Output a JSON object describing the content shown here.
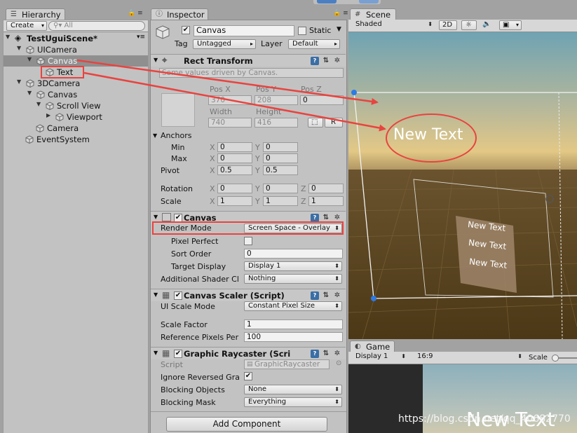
{
  "hierarchy": {
    "tab": "Hierarchy",
    "create": "Create",
    "search_placeholder": "All",
    "items": [
      {
        "label": "TestUguiScene*"
      },
      {
        "label": "UICamera"
      },
      {
        "label": "Canvas"
      },
      {
        "label": "Text"
      },
      {
        "label": "3DCamera"
      },
      {
        "label": "Canvas"
      },
      {
        "label": "Scroll View"
      },
      {
        "label": "Viewport"
      },
      {
        "label": "Camera"
      },
      {
        "label": "EventSystem"
      }
    ]
  },
  "inspector": {
    "tab": "Inspector",
    "object_name": "Canvas",
    "static_label": "Static",
    "tag_label": "Tag",
    "tag_value": "Untagged",
    "layer_label": "Layer",
    "layer_value": "Default",
    "rect_transform": {
      "title": "Rect Transform",
      "driven_note": "Some values driven by Canvas.",
      "pos_x_label": "Pos X",
      "pos_y_label": "Pos Y",
      "pos_z_label": "Pos Z",
      "pos_x": "370",
      "pos_y": "208",
      "pos_z": "0",
      "width_label": "Width",
      "height_label": "Height",
      "width": "740",
      "height": "416",
      "r_button": "R",
      "anchors_label": "Anchors",
      "min_label": "Min",
      "max_label": "Max",
      "x_label": "X",
      "y_label": "Y",
      "z_label": "Z",
      "min_x": "0",
      "min_y": "0",
      "max_x": "0",
      "max_y": "0",
      "pivot_label": "Pivot",
      "pivot_x": "0.5",
      "pivot_y": "0.5",
      "rotation_label": "Rotation",
      "rot_x": "0",
      "rot_y": "0",
      "rot_z": "0",
      "scale_label": "Scale",
      "scale_x": "1",
      "scale_y": "1",
      "scale_z": "1"
    },
    "canvas": {
      "title": "Canvas",
      "render_mode_label": "Render Mode",
      "render_mode_value": "Screen Space - Overlay",
      "pixel_perfect_label": "Pixel Perfect",
      "sort_order_label": "Sort Order",
      "sort_order": "0",
      "target_display_label": "Target Display",
      "target_display": "Display 1",
      "shader_label": "Additional Shader Cl",
      "shader_value": "Nothing"
    },
    "canvas_scaler": {
      "title": "Canvas Scaler (Script)",
      "ui_scale_label": "UI Scale Mode",
      "ui_scale_value": "Constant Pixel Size",
      "scale_factor_label": "Scale Factor",
      "scale_factor": "1",
      "ref_pixels_label": "Reference Pixels Per",
      "ref_pixels": "100"
    },
    "raycaster": {
      "title": "Graphic Raycaster (Scri",
      "script_label": "Script",
      "script_value": "GraphicRaycaster",
      "ignore_label": "Ignore Reversed Gra",
      "blocking_objects_label": "Blocking Objects",
      "blocking_objects": "None",
      "blocking_mask_label": "Blocking Mask",
      "blocking_mask": "Everything"
    },
    "add_component": "Add Component"
  },
  "scene": {
    "tab": "Scene",
    "shading": "Shaded",
    "mode_2d": "2D",
    "overlay_text": "New Text",
    "canvas_texts": [
      "New Text",
      "New Text",
      "New Text"
    ]
  },
  "game": {
    "tab": "Game",
    "display": "Display 1",
    "aspect": "16:9",
    "scale_label": "Scale",
    "overlay_text": "New Text"
  },
  "watermark": "https://blog.csdn.net/qq_40682770",
  "colors": {
    "annotation": "#e9433f",
    "selection": "#8f8f8f"
  }
}
